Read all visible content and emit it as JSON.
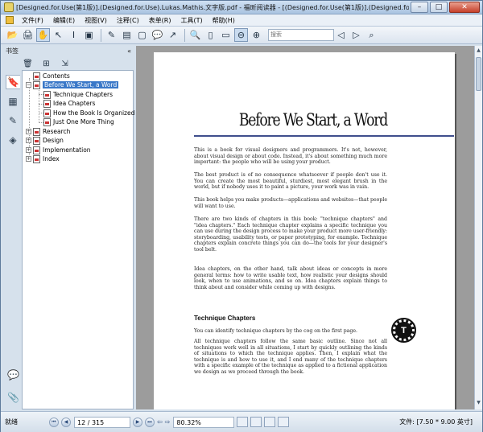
{
  "window": {
    "title": "[Designed.for.Use(第1版)].(Designed.for.Use).Lukas.Mathis.文字版.pdf - 福昕阅读器 - [(Designed.for.Use(第1版)].(Designed.for.Use).Lukas...",
    "minimize": "–",
    "maximize": "□",
    "close": "✕"
  },
  "menu": [
    "文件(F)",
    "编辑(E)",
    "视图(V)",
    "注释(C)",
    "表单(R)",
    "工具(T)",
    "帮助(H)"
  ],
  "toolbar": {
    "search_placeholder": "搜索"
  },
  "sidebar": {
    "title": "书签",
    "collapse": "«"
  },
  "bookmarks": [
    {
      "label": "Contents",
      "expander": ""
    },
    {
      "label": "Before We Start, a Word",
      "expander": "−"
    },
    {
      "label": "Technique Chapters",
      "expander": ""
    },
    {
      "label": "Idea Chapters",
      "expander": ""
    },
    {
      "label": "How the Book Is Organized",
      "expander": ""
    },
    {
      "label": "Just One More Thing",
      "expander": ""
    },
    {
      "label": "Research",
      "expander": "+"
    },
    {
      "label": "Design",
      "expander": "+"
    },
    {
      "label": "Implementation",
      "expander": "+"
    },
    {
      "label": "Index",
      "expander": "+"
    }
  ],
  "page": {
    "title": "Before We Start, a Word",
    "paragraphs": [
      "This is a book for visual designers and programmers. It's not, however, about visual design or about code. Instead, it's about something much more important: the people who will be using your product.",
      "The best product is of no consequence whatsoever if people don't use it. You can create the most beautiful, sturdiest, most elegant brush in the world, but if nobody uses it to paint a picture, your work was in vain.",
      "This book helps you make products—applications and websites—that people will want to use.",
      "There are two kinds of chapters in this book: \"technique chapters\" and \"idea chapters.\" Each technique chapter explains a specific technique you can use during the design process to make your product more user-friendly: storyboarding, usability tests, or paper prototyping, for example. Technique chapters explain concrete things you can do—the tools for your designer's tool belt.",
      "Idea chapters, on the other hand, talk about ideas or concepts in more general terms: how to write usable text, how realistic your designs should look, when to use animations, and so on. Idea chapters explain things to think about and consider while coming up with designs."
    ],
    "section_heading": "Technique Chapters",
    "section_paragraphs": [
      "You can identify technique chapters by the cog on the first page.",
      "All technique chapters follow the same basic outline. Since not all techniques work well in all situations, I start by quickly outlining the kinds of situations to which the technique applies. Then, I explain what the technique is and how to use it, and I end many of the technique chapters with a specific example of the technique as applied to a fictional application we design as we proceed through the book."
    ],
    "cog_glyph": "T"
  },
  "status": {
    "ready": "就绪",
    "page_field": "12 / 315",
    "zoom": "80.32%",
    "doc_size": "文件: [7.50 * 9.00 英寸]"
  }
}
